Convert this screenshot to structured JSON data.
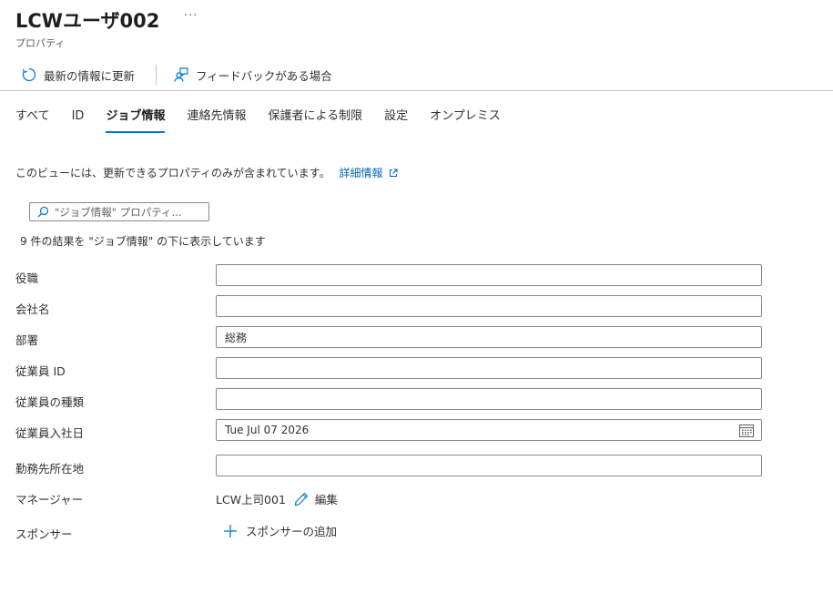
{
  "header": {
    "title": "LCWユーザ002",
    "more": "···",
    "subtitle": "プロパティ"
  },
  "commands": {
    "refresh": "最新の情報に更新",
    "feedback": "フィードバックがある場合"
  },
  "tabs": [
    "すべて",
    "ID",
    "ジョブ情報",
    "連絡先情報",
    "保護者による制限",
    "設定",
    "オンプレミス"
  ],
  "active_tab": "ジョブ情報",
  "info": {
    "text": "このビューには、更新できるプロパティのみが含まれています。",
    "link": "詳細情報"
  },
  "search": {
    "placeholder": "\"ジョブ情報\" プロパティ..."
  },
  "result_count": "9 件の結果を \"ジョブ情報\" の下に表示しています",
  "fields": {
    "job_title": {
      "label": "役職",
      "value": ""
    },
    "company": {
      "label": "会社名",
      "value": ""
    },
    "department": {
      "label": "部署",
      "value": "総務"
    },
    "employee_id": {
      "label": "従業員 ID",
      "value": ""
    },
    "employee_type": {
      "label": "従業員の種類",
      "value": ""
    },
    "hire_date": {
      "label": "従業員入社日",
      "value": "Tue Jul 07 2026"
    },
    "office_location": {
      "label": "勤務先所在地",
      "value": ""
    },
    "manager": {
      "label": "マネージャー",
      "value": "LCW上司001",
      "edit": "編集"
    },
    "sponsor": {
      "label": "スポンサー",
      "add": "スポンサーの追加"
    }
  },
  "colors": {
    "accent": "#0078d4",
    "link": "#0067b8",
    "border": "#8a8886"
  },
  "icons": {
    "refresh": "refresh-icon",
    "feedback": "feedback-icon",
    "external": "external-link-icon",
    "search": "search-icon",
    "calendar": "calendar-icon",
    "edit": "pencil-icon",
    "add": "plus-icon"
  }
}
